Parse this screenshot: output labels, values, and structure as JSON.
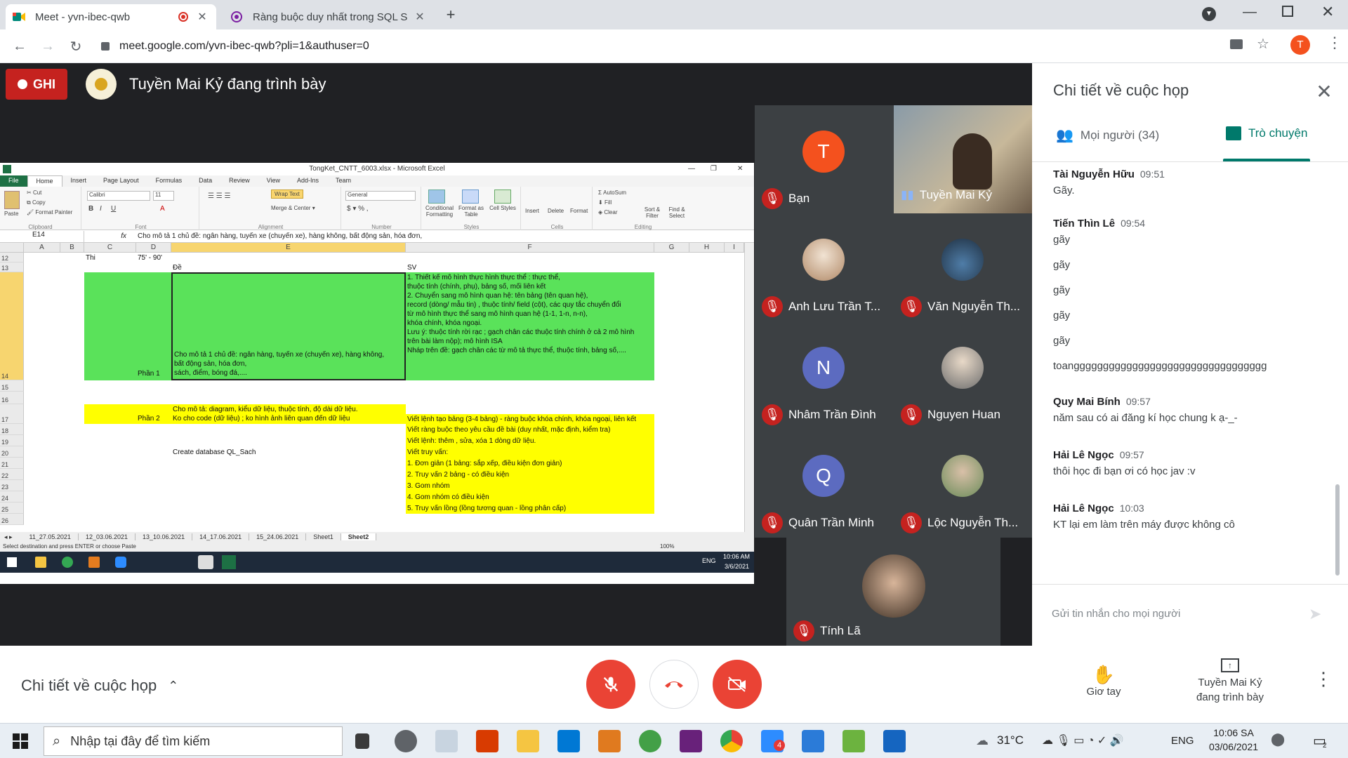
{
  "browser": {
    "tabs": [
      {
        "title": "Meet - yvn-ibec-qwb",
        "icon": "google-meet-icon",
        "recording": true
      },
      {
        "title": "Ràng buộc duy nhất trong SQL S",
        "icon": "site-favicon-icon"
      }
    ],
    "new_tab": "+",
    "url": "meet.google.com/yvn-ibec-qwb?pli=1&authuser=0",
    "profile_initial": "T"
  },
  "meet": {
    "recording_label": "GHI",
    "presenting_text": "Tuyền Mai Kỷ đang trình bày"
  },
  "excel": {
    "title": "TongKet_CNTT_6003.xlsx - Microsoft Excel",
    "ribbon_tabs": [
      "File",
      "Home",
      "Insert",
      "Page Layout",
      "Formulas",
      "Data",
      "Review",
      "View",
      "Add-Ins",
      "Team"
    ],
    "ribbon": {
      "paste": "Paste",
      "cut": "Cut",
      "copy": "Copy",
      "format_painter": "Format Painter",
      "clipboard": "Clipboard",
      "font_name": "Calibri",
      "font_size": "11",
      "font": "Font",
      "wrap_text": "Wrap Text",
      "merge_center": "Merge & Center",
      "alignment": "Alignment",
      "number_format": "General",
      "number": "Number",
      "conditional": "Conditional Formatting",
      "format_table": "Format as Table",
      "cell_styles": "Cell Styles",
      "styles": "Styles",
      "insert": "Insert",
      "delete": "Delete",
      "format": "Format",
      "cells": "Cells",
      "autosum": "AutoSum",
      "fill": "Fill",
      "clear": "Clear",
      "sort_filter": "Sort & Filter",
      "find_select": "Find & Select",
      "editing": "Editing"
    },
    "name_box": "E14",
    "fx": "fx",
    "formula": "Cho mô tả 1 chủ đề: ngân hàng, tuyến xe (chuyến xe), hàng không, bất động sản, hóa đơn,",
    "columns": [
      "A",
      "B",
      "C",
      "D",
      "E",
      "F",
      "G",
      "H",
      "I"
    ],
    "rows": [
      "12",
      "13",
      "14",
      "15",
      "16",
      "17",
      "18",
      "19",
      "20",
      "21",
      "22",
      "23",
      "24",
      "25",
      "26"
    ],
    "cells": {
      "c12": "Thi",
      "d12": "75' - 90'",
      "e13": "Đề",
      "f13": "SV",
      "d14": "Phần 1",
      "e14": "Cho mô tả 1 chủ đề: ngân hàng, tuyến xe (chuyến xe), hàng không,\nbất động sản, hóa đơn,\nsách, điểm, bóng đá,....",
      "f14": "1. Thiết kế mô hình thực hình thực thể : thực thể,\nthuộc tính (chính, phụ), bảng số, mối liên kết\n2. Chuyển sang mô hình quan hệ: tên bảng (tên quan hệ),\nrecord (dòng/ mẫu tin) , thuộc tính/ field (cột), các quy tắc chuyển đổi\ntừ mô hình thực thể sang mô hình quan hệ (1-1, 1-n, n-n),\nkhóa chính, khóa ngoại.\nLưu ý: thuộc tính rời rạc ; gạch chân các thuộc tính chính ở cả 2 mô hình\ntrên bài làm nộp); mô hình ISA\nNháp trên đề: gạch chân các từ mô tả thực thể, thuộc tính, bảng số,....",
      "d17": "Phần 2",
      "e17": "Cho mô tả: diagram, kiểu dữ liệu, thuộc tính, độ dài dữ liệu.\nKo cho code (dữ liệu) ; ko  hình ảnh liên quan đến dữ liệu",
      "f17": "Viết lệnh tạo bảng (3-4 bảng) - ràng buộc khóa chính, khóa ngoại, liên kết",
      "f18": "Viết ràng buộc theo yêu cầu đề bài (duy nhất, mặc định, kiểm tra)",
      "f19": "Viết lệnh: thêm , sửa, xóa 1 dòng dữ liệu.",
      "e20": "Create database QL_Sach",
      "f20": "Viết truy vấn:",
      "f21": "1. Đơn giản (1 bảng: sắp xếp, điều kiện đơn giản)",
      "f22": "2. Truy vấn 2 bảng - có điều kiện",
      "f23": "3. Gom nhóm",
      "f24": "4. Gom nhóm có điều kiện",
      "f25": "5. Truy vấn lồng (lồng tương quan - lồng phân cấp)"
    },
    "sheet_tabs": [
      "11_27.05.2021",
      "12_03.06.2021",
      "13_10.06.2021",
      "14_17.06.2021",
      "15_24.06.2021",
      "Sheet1",
      "Sheet2"
    ],
    "status": "Select destination and press ENTER or choose Paste",
    "zoom": "100%",
    "taskbar_lang": "ENG",
    "taskbar_time": "10:06 AM",
    "taskbar_date": "3/6/2021"
  },
  "participants": [
    {
      "name": "Bạn",
      "initial": "T",
      "color": "#f4511e"
    },
    {
      "name": "Tuyền Mai Kỷ",
      "video": true
    },
    {
      "name": "Anh Lưu Trần T...",
      "photo": "cat-photo"
    },
    {
      "name": "Văn Nguyễn Th...",
      "photo": "car-photo"
    },
    {
      "name": "Nhâm Trần Đình",
      "initial": "N",
      "color": "#5c6bc0"
    },
    {
      "name": "Nguyen Huan",
      "photo": "person-photo"
    },
    {
      "name": "Quân Trần Minh",
      "initial": "Q",
      "color": "#5c6bc0"
    },
    {
      "name": "Lộc Nguyễn Th...",
      "photo": "couple-photo"
    },
    {
      "name": "Tính Lã",
      "photo": "boy-photo"
    }
  ],
  "panel": {
    "title": "Chi tiết về cuộc họp",
    "tab_people": "Mọi người (34)",
    "tab_chat": "Trò chuyện",
    "messages": [
      {
        "sender": "Tài Nguyễn Hữu",
        "time": "09:51",
        "lines": [
          "Gãy."
        ]
      },
      {
        "sender": "Tiến Thìn Lê",
        "time": "09:54",
        "lines": [
          "gãy",
          "gãy",
          "gãy",
          "gãy",
          "gãy",
          "toanggggggggggggggggggggggggggggggggg"
        ]
      },
      {
        "sender": "Quy Mai Bính",
        "time": "09:57",
        "lines": [
          "năm sau có ai đăng kí học chung k ạ-_-"
        ]
      },
      {
        "sender": "Hải Lê Ngọc",
        "time": "09:57",
        "lines": [
          "thôi học đi bạn ơi có học jav :v"
        ]
      },
      {
        "sender": "Hải Lê Ngọc",
        "time": "10:03",
        "lines": [
          "KT lại em làm trên máy được không cô"
        ]
      }
    ],
    "input_placeholder": "Gửi tin nhắn cho mọi người"
  },
  "bottom": {
    "details_label": "Chi tiết về cuộc họp",
    "raise_hand": "Giơ tay",
    "presenting_line1": "Tuyền Mai Kỷ",
    "presenting_line2": "đang trình bày"
  },
  "taskbar": {
    "search_placeholder": "Nhập tại đây để tìm kiếm",
    "temperature": "31°C",
    "lang": "ENG",
    "time": "10:06 SA",
    "date": "03/06/2021",
    "zalo_badge": "4",
    "notif_badge": "2"
  }
}
